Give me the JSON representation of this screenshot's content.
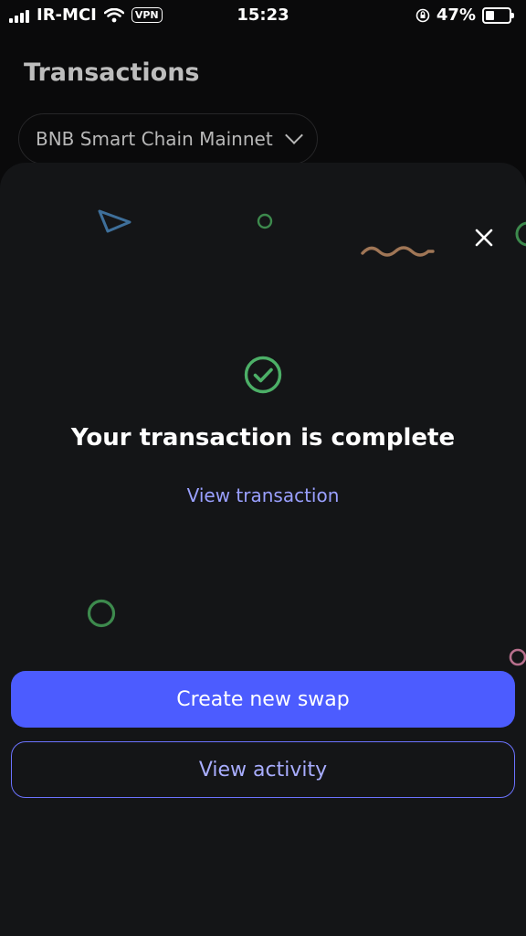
{
  "status_bar": {
    "carrier": "IR-MCI",
    "vpn": "VPN",
    "time": "15:23",
    "battery": "47%",
    "battery_level": 0.47
  },
  "page": {
    "title": "Transactions",
    "network": "BNB Smart Chain Mainnet"
  },
  "modal": {
    "headline": "Your transaction is complete",
    "link": "View transaction",
    "primary_button": "Create new swap",
    "secondary_button": "View activity"
  },
  "colors": {
    "accent": "#4c5cff",
    "success": "#4caf67",
    "link": "#9aa0ff"
  }
}
